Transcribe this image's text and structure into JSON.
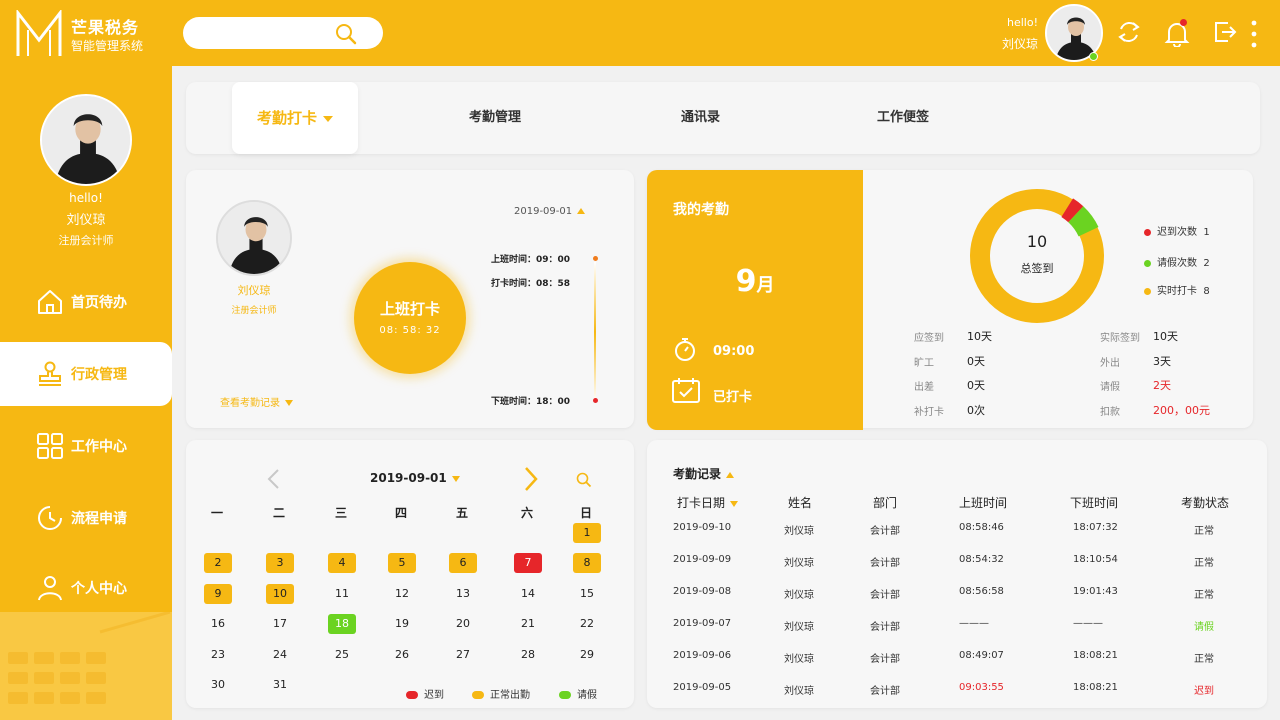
{
  "header": {
    "app_name": "芒果税务",
    "app_subtitle": "智能管理系统",
    "hello": "hello!",
    "user_name": "刘仪琼",
    "colors": {
      "brand": "#f6b813",
      "late": "#e6262a",
      "leave": "#6bd321"
    }
  },
  "sidebar": {
    "hello": "hello!",
    "name": "刘仪琼",
    "role": "注册会计师",
    "items": [
      {
        "label": "首页待办",
        "icon": "home-icon"
      },
      {
        "label": "行政管理",
        "icon": "stamp-icon",
        "active": true
      },
      {
        "label": "工作中心",
        "icon": "grid-icon"
      },
      {
        "label": "流程申请",
        "icon": "clock-icon"
      },
      {
        "label": "个人中心",
        "icon": "user-icon"
      }
    ]
  },
  "tabs": [
    "考勤打卡",
    "考勤管理",
    "通讯录",
    "工作便签"
  ],
  "punch": {
    "name": "刘仪琼",
    "role": "注册会计师",
    "button_title": "上班打卡",
    "button_clock": "08: 58: 32",
    "date": "2019-09-01",
    "start_time": "上班时间：09：00",
    "punch_time": "打卡时间：08：58",
    "end_time": "下班时间：18：00",
    "view_records": "查看考勤记录"
  },
  "my_attendance": {
    "title": "我的考勤",
    "month_num": "9",
    "month_unit": "月",
    "time": "09:00",
    "status": "已打卡",
    "total": "10",
    "total_label": "总签到",
    "legend": [
      {
        "label": "迟到次数",
        "value": "1",
        "color": "#e6262a"
      },
      {
        "label": "请假次数",
        "value": "2",
        "color": "#6bd321"
      },
      {
        "label": "实时打卡",
        "value": "8",
        "color": "#f6b813"
      }
    ],
    "stats_left": [
      {
        "label": "应签到",
        "value": "10天"
      },
      {
        "label": "旷工",
        "value": "0天"
      },
      {
        "label": "出差",
        "value": "0天"
      },
      {
        "label": "补打卡",
        "value": "0次"
      }
    ],
    "stats_right": [
      {
        "label": "实际签到",
        "value": "10天"
      },
      {
        "label": "外出",
        "value": "3天"
      },
      {
        "label": "请假",
        "value": "2天"
      },
      {
        "label": "扣款",
        "value": "200，00元"
      }
    ]
  },
  "calendar": {
    "month": "2019-09-01",
    "weekdays": [
      "一",
      "二",
      "三",
      "四",
      "五",
      "六",
      "日"
    ],
    "days": [
      {
        "d": "1",
        "s": "n"
      },
      {
        "d": "2",
        "s": "n"
      },
      {
        "d": "3",
        "s": "n"
      },
      {
        "d": "4",
        "s": "n"
      },
      {
        "d": "5",
        "s": "n"
      },
      {
        "d": "6",
        "s": "n"
      },
      {
        "d": "7",
        "s": "l"
      },
      {
        "d": "8",
        "s": "n"
      },
      {
        "d": "9",
        "s": "n"
      },
      {
        "d": "10",
        "s": "n"
      },
      {
        "d": "11",
        "s": ""
      },
      {
        "d": "12",
        "s": ""
      },
      {
        "d": "13",
        "s": ""
      },
      {
        "d": "14",
        "s": ""
      },
      {
        "d": "15",
        "s": ""
      },
      {
        "d": "16",
        "s": ""
      },
      {
        "d": "17",
        "s": ""
      },
      {
        "d": "18",
        "s": "q"
      },
      {
        "d": "19",
        "s": ""
      },
      {
        "d": "20",
        "s": ""
      },
      {
        "d": "21",
        "s": ""
      },
      {
        "d": "22",
        "s": ""
      },
      {
        "d": "23",
        "s": ""
      },
      {
        "d": "24",
        "s": ""
      },
      {
        "d": "25",
        "s": ""
      },
      {
        "d": "26",
        "s": ""
      },
      {
        "d": "27",
        "s": ""
      },
      {
        "d": "28",
        "s": ""
      },
      {
        "d": "29",
        "s": ""
      },
      {
        "d": "30",
        "s": ""
      },
      {
        "d": "31",
        "s": ""
      }
    ],
    "legend": [
      {
        "label": "迟到",
        "color": "#e6262a"
      },
      {
        "label": "正常出勤",
        "color": "#f6b813"
      },
      {
        "label": "请假",
        "color": "#6bd321"
      }
    ]
  },
  "records": {
    "title": "考勤记录",
    "headers": [
      "打卡日期",
      "姓名",
      "部门",
      "上班时间",
      "下班时间",
      "考勤状态"
    ],
    "rows": [
      [
        "2019-09-10",
        "刘仪琼",
        "会计部",
        "08:58:46",
        "18:07:32",
        "正常"
      ],
      [
        "2019-09-09",
        "刘仪琼",
        "会计部",
        "08:54:32",
        "18:10:54",
        "正常"
      ],
      [
        "2019-09-08",
        "刘仪琼",
        "会计部",
        "08:56:58",
        "19:01:43",
        "正常"
      ],
      [
        "2019-09-07",
        "刘仪琼",
        "会计部",
        "———",
        "———",
        "请假"
      ],
      [
        "2019-09-06",
        "刘仪琼",
        "会计部",
        "08:49:07",
        "18:08:21",
        "正常"
      ],
      [
        "2019-09-05",
        "刘仪琼",
        "会计部",
        "09:03:55",
        "18:08:21",
        "迟到"
      ]
    ]
  }
}
